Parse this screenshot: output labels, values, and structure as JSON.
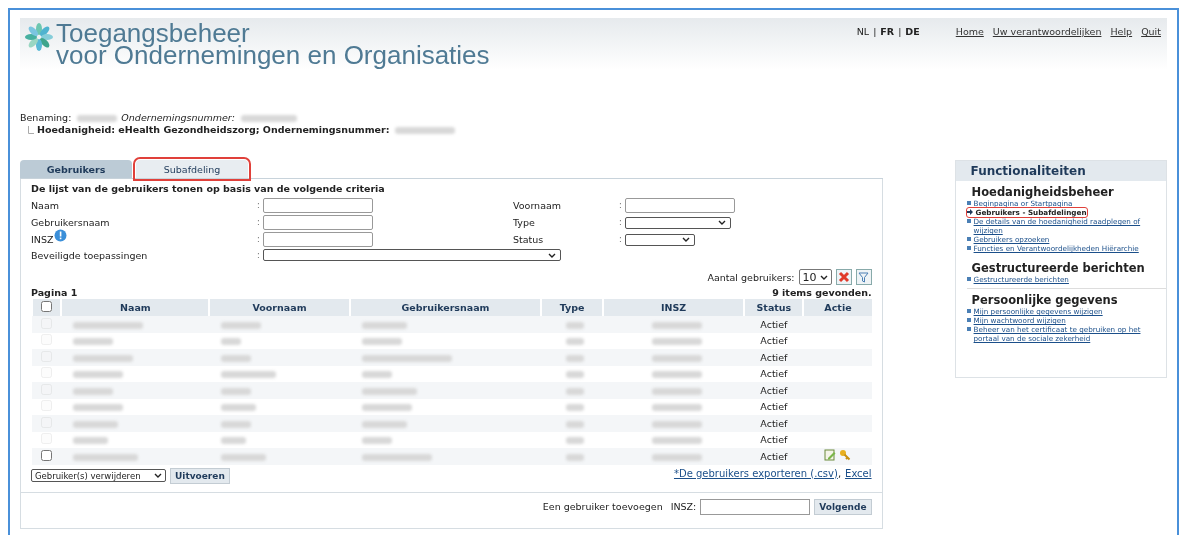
{
  "header": {
    "title_line1": "Toegangsbeheer",
    "title_line2": "voor Ondernemingen en Organisaties",
    "lang_separator": "|",
    "languages": [
      {
        "code": "NL",
        "selected": true
      },
      {
        "code": "FR",
        "selected": false
      },
      {
        "code": "DE",
        "selected": false
      }
    ],
    "links": [
      "Home",
      "Uw verantwoordelijken",
      "Help",
      "Quit"
    ]
  },
  "context": {
    "benaming_label": "Benaming:",
    "nummer_label": "Ondernemingsnummer:",
    "hoedanigheid": "Hoedanigheid: eHealth Gezondheidszorg; Ondernemingsnummer:"
  },
  "tabs": [
    {
      "label": "Gebruikers",
      "selected": true,
      "highlighted": false
    },
    {
      "label": "Subafdeling",
      "selected": false,
      "highlighted": true
    }
  ],
  "criteria": {
    "title": "De lijst van de gebruikers tonen op basis van de volgende criteria",
    "left": [
      {
        "label": "Naam",
        "kind": "input",
        "info": false
      },
      {
        "label": "Gebruikersnaam",
        "kind": "input",
        "info": false
      },
      {
        "label": "INSZ",
        "kind": "input",
        "info": true
      }
    ],
    "right": [
      {
        "label": "Voornaam",
        "kind": "input"
      },
      {
        "label": "Type",
        "kind": "select"
      },
      {
        "label": "Status",
        "kind": "select"
      }
    ],
    "apps_label": "Beveiligde toepassingen",
    "separator": ":"
  },
  "count": {
    "label": "Aantal gebruikers:",
    "value": "10"
  },
  "page": "Pagina 1",
  "found": "9 items gevonden.",
  "select_all_checked": false,
  "columns": [
    "Naam",
    "Voornaam",
    "Gebruikersnaam",
    "Type",
    "INSZ",
    "Status",
    "Actie"
  ],
  "rows": [
    {
      "status": "Actief",
      "disabled": true,
      "actions": false
    },
    {
      "status": "Actief",
      "disabled": true,
      "actions": false
    },
    {
      "status": "Actief",
      "disabled": true,
      "actions": false
    },
    {
      "status": "Actief",
      "disabled": true,
      "actions": false
    },
    {
      "status": "Actief",
      "disabled": true,
      "actions": false
    },
    {
      "status": "Actief",
      "disabled": true,
      "actions": false
    },
    {
      "status": "Actief",
      "disabled": true,
      "actions": false
    },
    {
      "status": "Actief",
      "disabled": true,
      "actions": false
    },
    {
      "status": "Actief",
      "disabled": false,
      "actions": true
    }
  ],
  "bulk": {
    "action": "Gebruiker(s) verwijderen",
    "button": "Uitvoeren"
  },
  "export": {
    "csv": "*De gebruikers exporteren (.csv)",
    "sep": ",",
    "excel": "Excel"
  },
  "add": {
    "label": "Een gebruiker toevoegen",
    "insz": "INSZ:",
    "button": "Volgende"
  },
  "sidebar": {
    "title": "Functionaliteiten",
    "sections": [
      {
        "title": "Hoedanigheidsbeheer",
        "items": [
          {
            "label": "Beginpagina or Startpagina",
            "current": false,
            "highlighted": false
          },
          {
            "label": "Gebruikers - Subafdelingen",
            "current": true,
            "highlighted": true
          },
          {
            "label": "De details van de hoedanigheid raadplegen of wijzigen",
            "current": false,
            "highlighted": false
          },
          {
            "label": "Gebruikers opzoeken",
            "current": false,
            "highlighted": false
          },
          {
            "label": "Functies en Verantwoordelijkheden Hiërarchie",
            "current": false,
            "highlighted": false
          }
        ]
      },
      {
        "title": "Gestructureerde berichten",
        "items": [
          {
            "label": "Gestructureerde berichten",
            "current": false,
            "highlighted": false
          }
        ]
      },
      {
        "title": "Persoonlijke gegevens",
        "items": [
          {
            "label": "Mijn persoonlijke gegevens wijzigen",
            "current": false,
            "highlighted": false
          },
          {
            "label": "Mijn wachtwoord wijzigen",
            "current": false,
            "highlighted": false
          },
          {
            "label": "Beheer van het certificaat te gebruiken op het portaal van de sociale zekerheid",
            "current": false,
            "highlighted": false
          }
        ]
      }
    ]
  }
}
